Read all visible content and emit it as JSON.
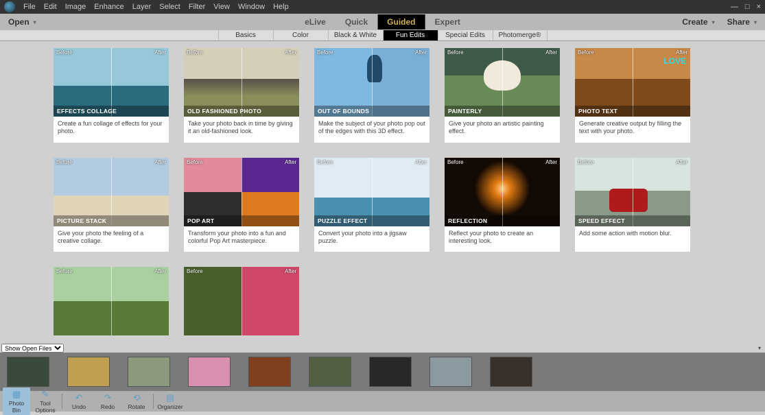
{
  "menu": {
    "items": [
      "File",
      "Edit",
      "Image",
      "Enhance",
      "Layer",
      "Select",
      "Filter",
      "View",
      "Window",
      "Help"
    ]
  },
  "modebar": {
    "open": "Open",
    "modes": [
      {
        "label": "eLive",
        "active": false
      },
      {
        "label": "Quick",
        "active": false
      },
      {
        "label": "Guided",
        "active": true
      },
      {
        "label": "Expert",
        "active": false
      }
    ],
    "create": "Create",
    "share": "Share"
  },
  "subtabs": [
    {
      "label": "Basics",
      "active": false
    },
    {
      "label": "Color",
      "active": false
    },
    {
      "label": "Black & White",
      "active": false
    },
    {
      "label": "Fun Edits",
      "active": true
    },
    {
      "label": "Special Edits",
      "active": false
    },
    {
      "label": "Photomerge®",
      "active": false
    }
  ],
  "labels": {
    "before": "Before",
    "after": "After"
  },
  "cards": [
    {
      "title": "EFFECTS COLLAGE",
      "desc": "Create a fun collage of effects for your photo."
    },
    {
      "title": "OLD FASHIONED PHOTO",
      "desc": "Take your photo back in time by giving it an old-fashioned look."
    },
    {
      "title": "OUT OF BOUNDS",
      "desc": "Make the subject of your photo pop out of the edges with this 3D effect."
    },
    {
      "title": "PAINTERLY",
      "desc": "Give your photo an artistic painting effect."
    },
    {
      "title": "PHOTO TEXT",
      "desc": "Generate creative output by filling the text with your photo."
    },
    {
      "title": "PICTURE STACK",
      "desc": "Give your photo the feeling of a creative collage."
    },
    {
      "title": "POP ART",
      "desc": "Transform your photo into a fun and colorful Pop Art masterpiece."
    },
    {
      "title": "PUZZLE EFFECT",
      "desc": "Convert your photo into a jigsaw puzzle."
    },
    {
      "title": "REFLECTION",
      "desc": "Reflect your photo to create an interesting look."
    },
    {
      "title": "SPEED EFFECT",
      "desc": "Add some action with motion blur."
    },
    {
      "title": "",
      "desc": ""
    },
    {
      "title": "",
      "desc": ""
    }
  ],
  "bin": {
    "select": "Show Open Files",
    "thumb_count": 9
  },
  "toolbar": {
    "photobin": "Photo Bin",
    "toolopts": "Tool Options",
    "undo": "Undo",
    "redo": "Redo",
    "rotate": "Rotate",
    "organizer": "Organizer"
  }
}
